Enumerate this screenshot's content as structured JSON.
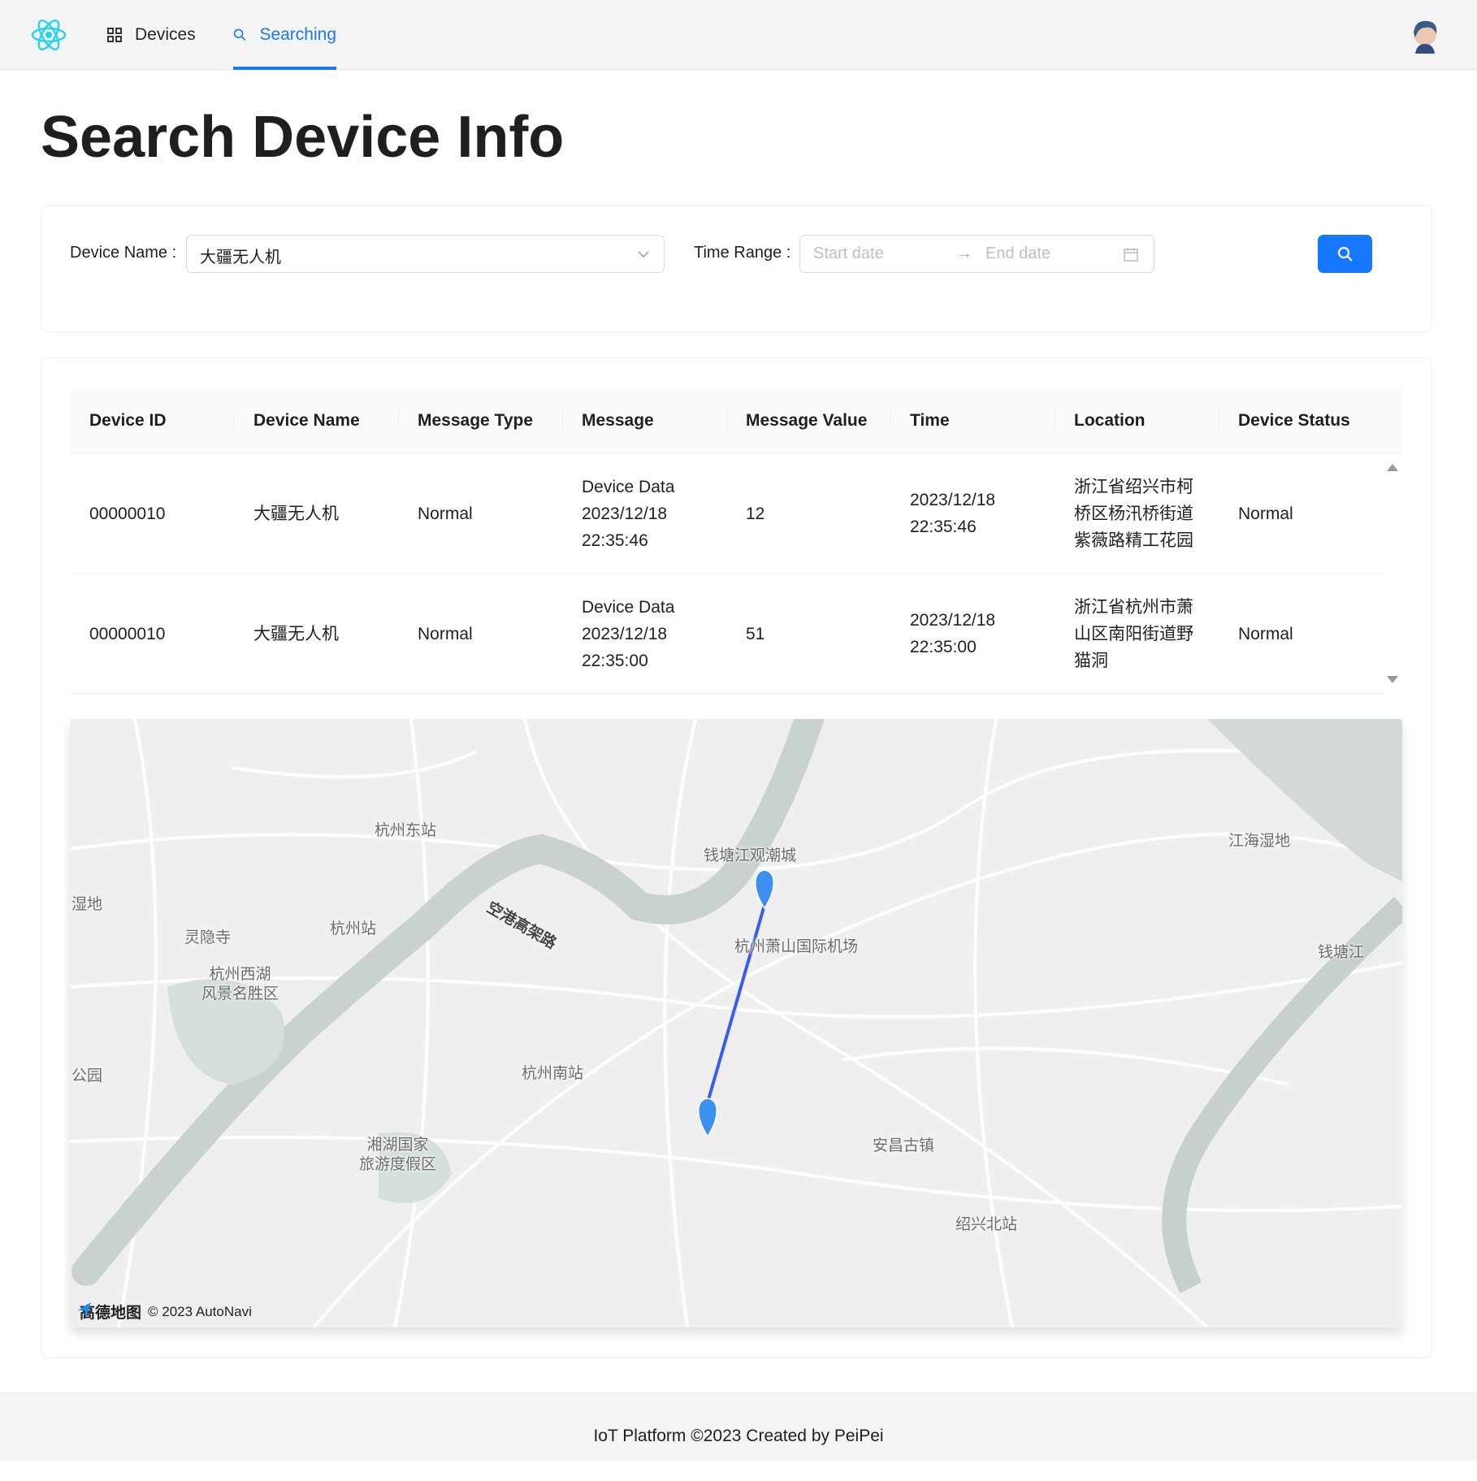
{
  "nav": {
    "items": [
      {
        "label": "Devices",
        "icon": "appstore-icon"
      },
      {
        "label": "Searching",
        "icon": "search-icon",
        "active": true
      }
    ]
  },
  "page": {
    "title": "Search Device Info"
  },
  "form": {
    "device_name_label": "Device Name",
    "device_name_value": "大疆无人机",
    "time_range_label": "Time Range",
    "start_placeholder": "Start date",
    "end_placeholder": "End date"
  },
  "table": {
    "columns": [
      "Device ID",
      "Device Name",
      "Message Type",
      "Message",
      "Message Value",
      "Time",
      "Location",
      "Device Status"
    ],
    "rows": [
      [
        "00000010",
        "大疆无人机",
        "Normal",
        "Device Data\n2023/12/18\n22:35:46",
        "12",
        "2023/12/18\n22:35:46",
        "浙江省绍兴市柯\n桥区杨汛桥街道\n紫薇路精工花园",
        "Normal"
      ],
      [
        "00000010",
        "大疆无人机",
        "Normal",
        "Device Data\n2023/12/18\n22:35:00",
        "51",
        "2023/12/18\n22:35:00",
        "浙江省杭州市萧\n山区南阳街道野\n猫洞",
        "Normal"
      ]
    ]
  },
  "map": {
    "labels": [
      "杭州东站",
      "钱塘江观潮城",
      "江海湿地",
      "湿地",
      "灵隐寺",
      "杭州站",
      "空港高架路",
      "杭州萧山国际机场",
      "钱塘江",
      "杭州西湖\n风景名胜区",
      "公园",
      "杭州南站",
      "湘湖国家\n旅游度假区",
      "安昌古镇",
      "绍兴北站"
    ],
    "brand": "高德地图",
    "copyright": "© 2023 AutoNavi",
    "route_color": "#3b5bf0",
    "marker_color": "#3d8ff0"
  },
  "footer": {
    "text": "IoT Platform ©2023 Created by PeiPei"
  },
  "colors": {
    "primary": "#1677ff",
    "logo": "#22d3ee"
  }
}
